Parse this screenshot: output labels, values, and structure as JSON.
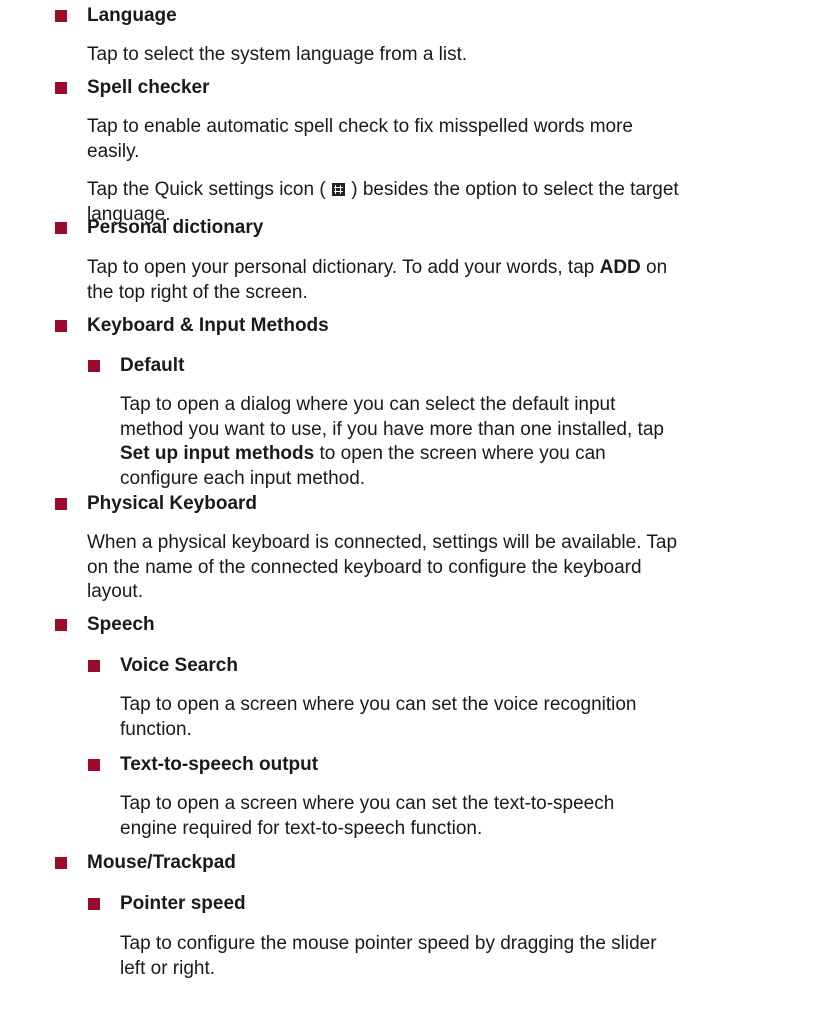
{
  "colors": {
    "bullet": "#9c0a2c",
    "text": "#1a1a1a"
  },
  "items": {
    "language": {
      "heading": "Language",
      "p1": "Tap to select the system language from a list."
    },
    "spell_checker": {
      "heading": "Spell checker",
      "p1_l1": "Tap to enable automatic spell check to fix misspelled words more",
      "p1_l2": "easily.",
      "p2_before_icon": "Tap the Quick settings icon (",
      "p2_icon": "quick-settings-icon",
      "p2_after_icon": ") besides the option to select the target",
      "p2_l2": "language."
    },
    "personal_dictionary": {
      "heading": "Personal dictionary",
      "p1_a": "Tap to open your personal dictionary. To add your words, tap ",
      "p1_bold": "ADD",
      "p1_b": " on",
      "p1_l2": "the top right of the screen."
    },
    "keyboard_input": {
      "heading": "Keyboard & Input Methods",
      "default": {
        "heading": "Default",
        "l1": "Tap to open a dialog where you can select the default input",
        "l2": "method you want to use, if you have more than one installed, tap",
        "l3_bold": "Set up input methods",
        "l3_rest": " to open the screen where you can",
        "l4": "configure each input method."
      }
    },
    "physical_keyboard": {
      "heading": "Physical Keyboard",
      "l1": "When a physical keyboard is connected, settings will be available. Tap",
      "l2": "on the name of the connected keyboard to configure the keyboard",
      "l3": "layout."
    },
    "speech": {
      "heading": "Speech",
      "voice_search": {
        "heading": "Voice Search",
        "l1": "Tap to open a screen where you can set the voice recognition",
        "l2": "function."
      },
      "tts": {
        "heading": "Text-to-speech output",
        "l1": "Tap to open a screen where you can set the text-to-speech",
        "l2": "engine required for text-to-speech function."
      }
    },
    "mouse": {
      "heading": "Mouse/Trackpad",
      "pointer_speed": {
        "heading": "Pointer speed",
        "l1": "Tap to configure the mouse pointer speed by dragging the slider",
        "l2": "left or right."
      }
    }
  }
}
